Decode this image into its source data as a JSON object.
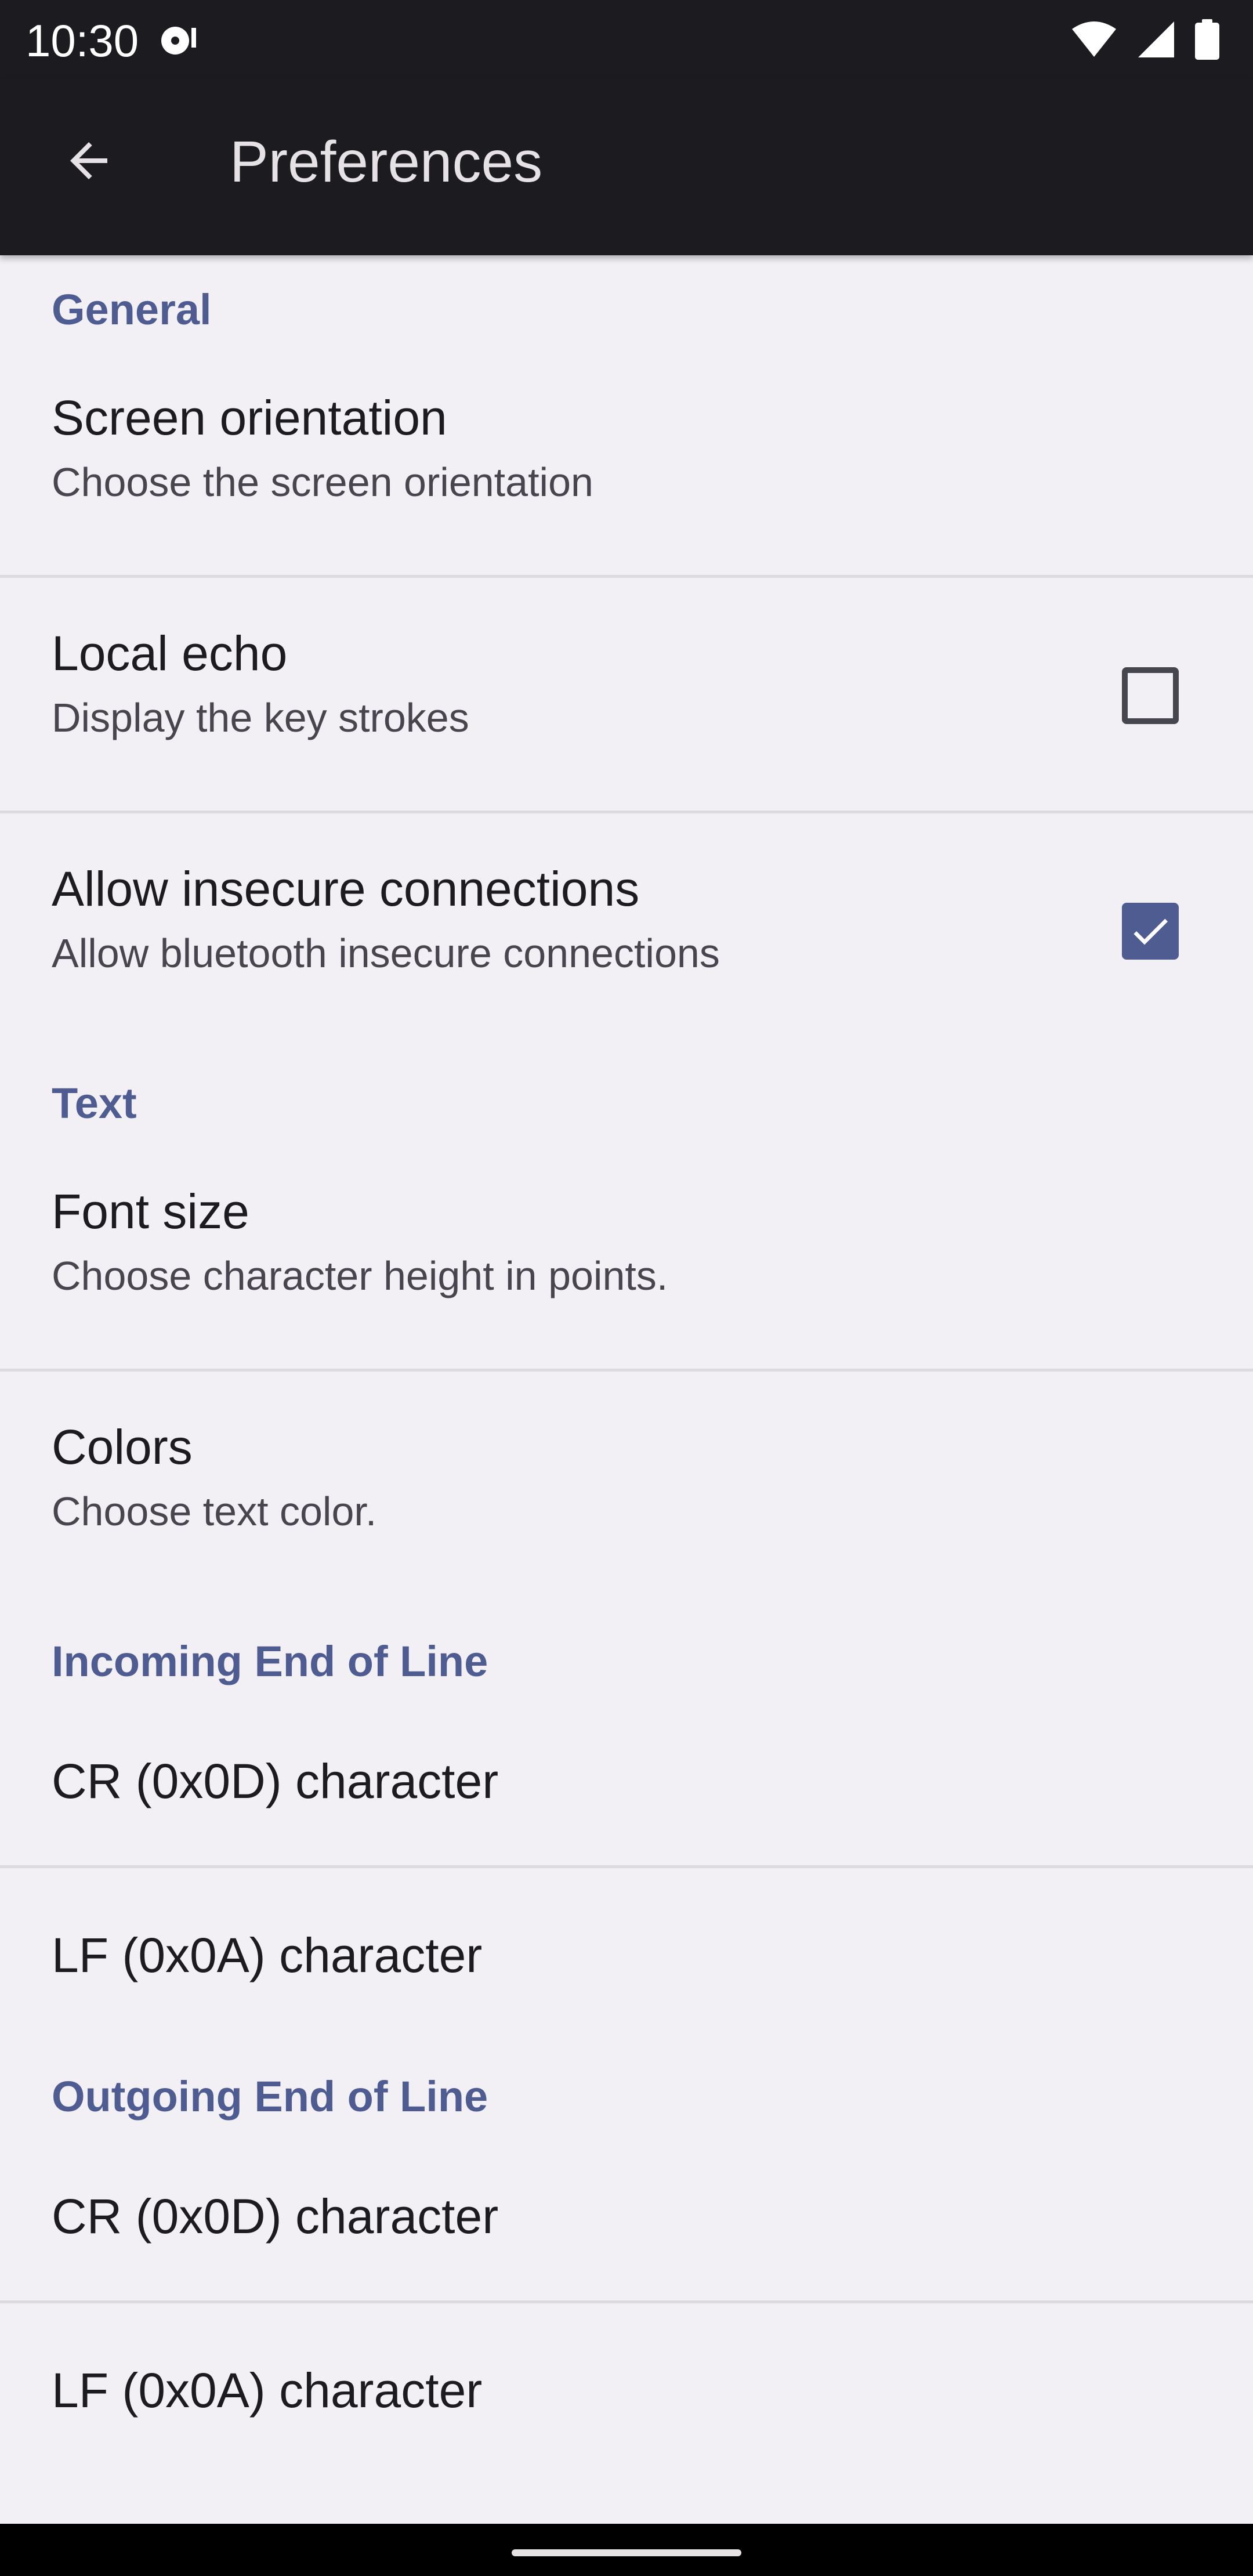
{
  "status_bar": {
    "time": "10:30",
    "notification_icon": "media-disc-icon",
    "icons": [
      "wifi-icon",
      "cellular-signal-icon",
      "battery-icon"
    ]
  },
  "app_bar": {
    "back_icon": "back-arrow-icon",
    "title": "Preferences"
  },
  "sections": {
    "general": {
      "title": "General",
      "screen_orientation": {
        "title": "Screen orientation",
        "summary": "Choose the screen orientation"
      },
      "local_echo": {
        "title": "Local echo",
        "summary": "Display the key strokes",
        "checked": false
      },
      "allow_insecure": {
        "title": "Allow insecure connections",
        "summary": "Allow bluetooth insecure connections",
        "checked": true
      }
    },
    "text": {
      "title": "Text",
      "font_size": {
        "title": "Font size",
        "summary": "Choose character height in points."
      },
      "colors": {
        "title": "Colors",
        "summary": "Choose text color."
      }
    },
    "incoming_eol": {
      "title": "Incoming End of Line",
      "cr": {
        "title": "CR (0x0D) character"
      },
      "lf": {
        "title": "LF (0x0A) character"
      }
    },
    "outgoing_eol": {
      "title": "Outgoing End of Line",
      "cr": {
        "title": "CR (0x0D) character"
      },
      "lf": {
        "title": "LF (0x0A) character"
      }
    }
  },
  "colors": {
    "accent": "#4E5C92",
    "background": "#F2F0F5",
    "app_bar": "#1C1B1F",
    "divider": "#DDDAE0"
  }
}
